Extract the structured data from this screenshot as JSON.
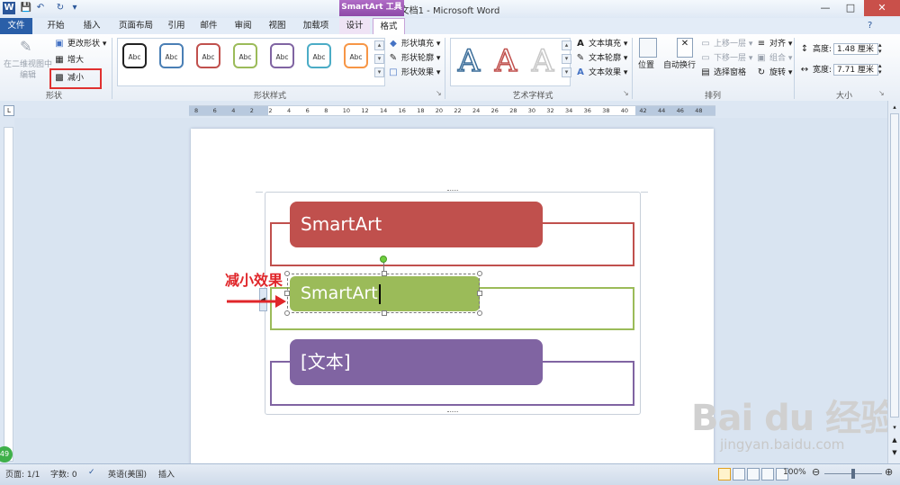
{
  "window": {
    "title": "文档1 - Microsoft Word",
    "context_tab": "SmartArt 工具",
    "controls": [
      "—",
      "□",
      "✕"
    ]
  },
  "tabs": [
    "文件",
    "开始",
    "插入",
    "页面布局",
    "引用",
    "邮件",
    "审阅",
    "视图",
    "加载项",
    "设计",
    "格式"
  ],
  "ribbon": {
    "shape_group": {
      "label": "形状",
      "edit_3d": "在二维视图中编辑",
      "change_shape": "更改形状",
      "larger": "增大",
      "smaller": "减小"
    },
    "shape_styles": {
      "label": "形状样式",
      "swatch_text": "Abc",
      "swatch_colors": [
        "#222222",
        "#4a7fb5",
        "#c0504d",
        "#9bbb59",
        "#8064a2",
        "#4bacc6",
        "#f79646"
      ],
      "fill": "形状填充",
      "outline": "形状轮廓",
      "effects": "形状效果"
    },
    "wordart": {
      "label": "艺术字样式",
      "letter": "A",
      "text_fill": "文本填充",
      "text_outline": "文本轮廓",
      "text_effects": "文本效果"
    },
    "arrange": {
      "label": "排列",
      "position": "位置",
      "wrap": "自动换行",
      "bring_forward": "上移一层",
      "send_backward": "下移一层",
      "selection_pane": "选择窗格",
      "align": "对齐",
      "group": "组合",
      "rotate": "旋转"
    },
    "size": {
      "label": "大小",
      "height_label": "高度:",
      "height_value": "1.48 厘米",
      "width_label": "宽度:",
      "width_value": "7.71 厘米"
    }
  },
  "ruler": {
    "ticks": [
      "8",
      "6",
      "4",
      "2",
      "2",
      "4",
      "6",
      "8",
      "10",
      "12",
      "14",
      "16",
      "18",
      "20",
      "22",
      "24",
      "26",
      "28",
      "30",
      "32",
      "34",
      "36",
      "38",
      "40",
      "42",
      "44",
      "46",
      "48"
    ]
  },
  "document": {
    "annotation": "减小效果",
    "items": [
      {
        "text": "SmartArt",
        "color": "#c0504d"
      },
      {
        "text": "SmartArt",
        "color": "#9bbb59"
      },
      {
        "text": "[文本]",
        "color": "#8064a2"
      }
    ]
  },
  "status": {
    "page": "页面: 1/1",
    "words": "字数: 0",
    "language": "英语(美国)",
    "mode": "插入",
    "zoom": "100%"
  },
  "watermark": {
    "brand": "Bai du 经验",
    "url": "jingyan.baidu.com"
  },
  "badge": "49"
}
